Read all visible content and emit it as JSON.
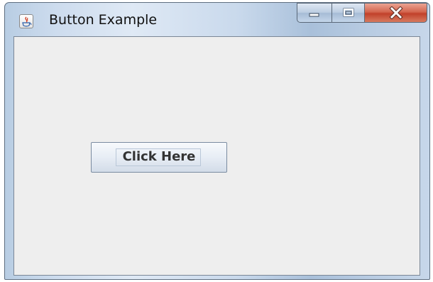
{
  "window": {
    "title": "Button Example",
    "icon": "java-cup-icon"
  },
  "caption_buttons": {
    "minimize_icon": "minimize-icon",
    "maximize_icon": "maximize-icon",
    "close_icon": "close-icon",
    "close_color": "#c8452f"
  },
  "content": {
    "button_label": "Click Here",
    "background": "#eeeeee"
  }
}
